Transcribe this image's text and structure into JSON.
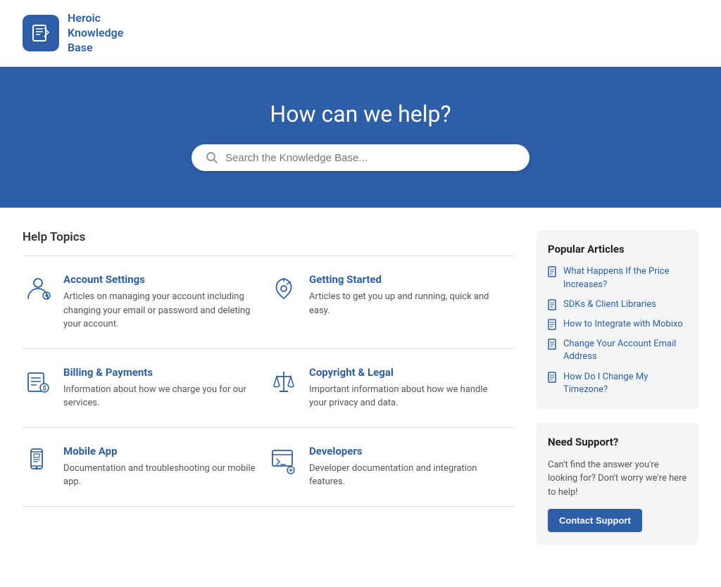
{
  "header": {
    "logo_alt": "Heroic Knowledge Base logo",
    "logo_title": "Heroic\nKnowledge\nBase"
  },
  "hero": {
    "title": "How can we help?",
    "search_placeholder": "Search the Knowledge Base..."
  },
  "topics_section": {
    "heading": "Help Topics",
    "topics": [
      {
        "id": "account-settings",
        "name": "Account Settings",
        "desc": "Articles on managing your account including changing your email or password and deleting your account."
      },
      {
        "id": "getting-started",
        "name": "Getting Started",
        "desc": "Articles to get you up and running, quick and easy."
      },
      {
        "id": "billing-payments",
        "name": "Billing & Payments",
        "desc": "Information about how we charge you for our services."
      },
      {
        "id": "copyright-legal",
        "name": "Copyright & Legal",
        "desc": "Important information about how we handle your privacy and data."
      },
      {
        "id": "mobile-app",
        "name": "Mobile App",
        "desc": "Documentation and troubleshooting our mobile app."
      },
      {
        "id": "developers",
        "name": "Developers",
        "desc": "Developer documentation and integration features."
      }
    ]
  },
  "sidebar": {
    "popular_articles": {
      "title": "Popular Articles",
      "items": [
        "What Happens If the Price Increases?",
        "SDKs & Client Libraries",
        "How to Integrate with Mobixo",
        "Change Your Account Email Address",
        "How Do I Change My Timezone?"
      ]
    },
    "support": {
      "title": "Need Support?",
      "desc": "Can't find the answer you're looking for? Don't worry we're here to help!",
      "button": "Contact Support"
    }
  }
}
